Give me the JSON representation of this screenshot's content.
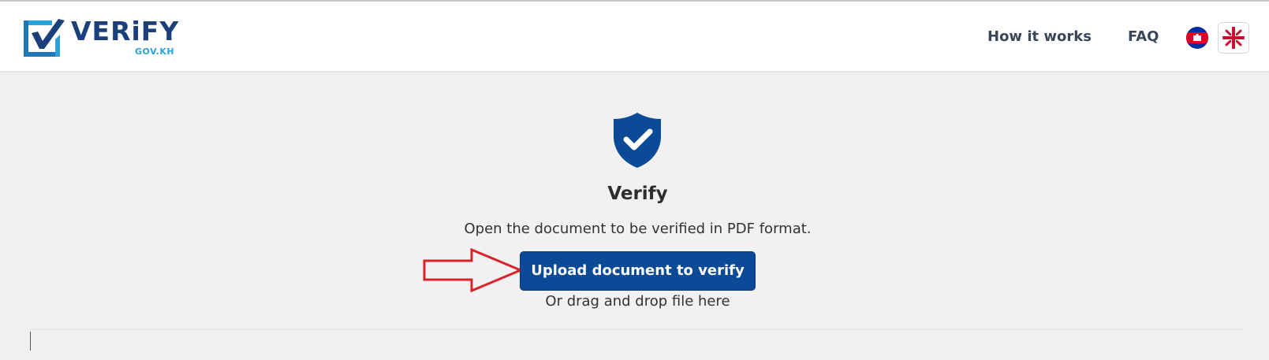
{
  "header": {
    "logo": {
      "wordmark": "VERiFY",
      "domain": "GOV.KH",
      "colors": {
        "navy": "#1b3f7a",
        "cyan": "#2aa3dc"
      }
    },
    "nav": {
      "how_it_works": "How it works",
      "faq": "FAQ"
    },
    "languages": [
      {
        "code": "km",
        "icon": "cambodia-flag-icon"
      },
      {
        "code": "en",
        "icon": "uk-flag-icon",
        "selected": true
      }
    ]
  },
  "main": {
    "icon": "shield-check-icon",
    "title": "Verify",
    "description": "Open the document to be verified in PDF format.",
    "upload_button": "Upload document to verify",
    "drag_hint": "Or drag and drop file here",
    "annotation": "red-arrow-pointing-right",
    "colors": {
      "primary": "#0b4a96",
      "annotation_red": "#d8232a"
    }
  }
}
